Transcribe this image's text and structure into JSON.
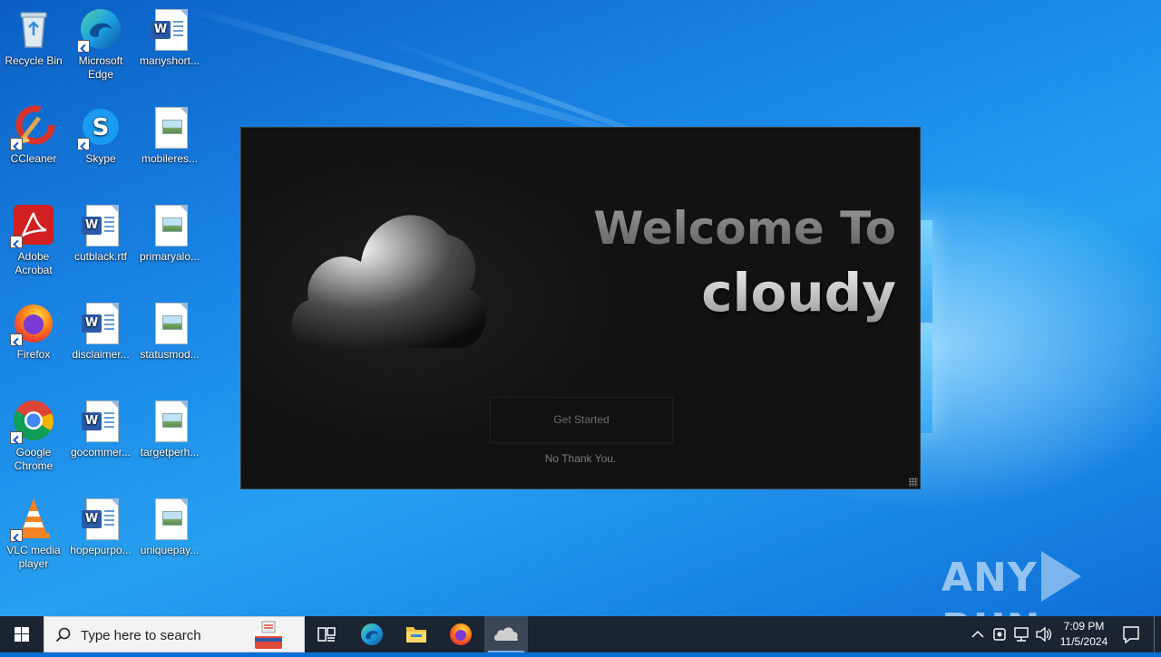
{
  "desktop": {
    "icons": [
      {
        "label": "Recycle Bin"
      },
      {
        "label": "Microsoft Edge"
      },
      {
        "label": "manyshort..."
      },
      {
        "label": "CCleaner"
      },
      {
        "label": "Skype"
      },
      {
        "label": "mobileres..."
      },
      {
        "label": "Adobe Acrobat"
      },
      {
        "label": "cutblack.rtf"
      },
      {
        "label": "primaryalo..."
      },
      {
        "label": "Firefox"
      },
      {
        "label": "disclaimer..."
      },
      {
        "label": "statusmod..."
      },
      {
        "label": "Google Chrome"
      },
      {
        "label": "gocommer..."
      },
      {
        "label": "targetperh..."
      },
      {
        "label": "VLC media player"
      },
      {
        "label": "hopepurpo..."
      },
      {
        "label": "uniquepay..."
      }
    ]
  },
  "app": {
    "welcome_line": "Welcome To",
    "brand": "cloudy",
    "get_started_label": "Get Started",
    "no_thanks_label": "No Thank You."
  },
  "watermark": {
    "left": "ANY",
    "right": "RUN"
  },
  "taskbar": {
    "search_placeholder": "Type here to search",
    "time": "7:09 PM",
    "date": "11/5/2024",
    "icons": [
      "windows-start-icon",
      "search-icon",
      "task-view-icon",
      "edge-icon",
      "file-explorer-icon",
      "firefox-icon",
      "cloudy-app-icon",
      "chevron-up-icon",
      "meet-now-icon",
      "network-icon",
      "volume-icon",
      "notification-icon"
    ]
  },
  "colors": {
    "taskbar_bg": "#1b2431",
    "app_bg": "#121212",
    "desktop_accent": "#1a86e6"
  }
}
